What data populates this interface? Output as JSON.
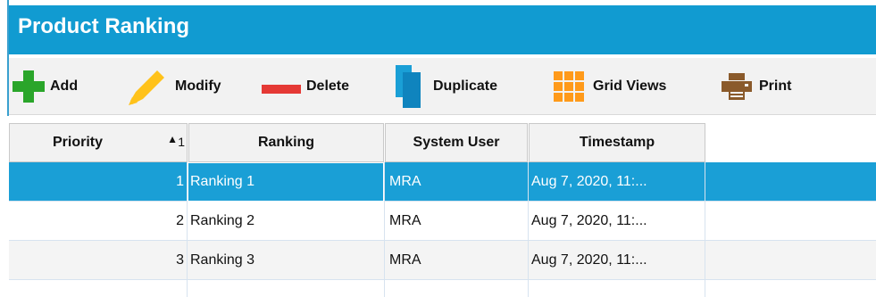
{
  "window": {
    "title": "Product Ranking"
  },
  "toolbar": {
    "add": "Add",
    "modify": "Modify",
    "delete": "Delete",
    "duplicate": "Duplicate",
    "grid_views": "Grid Views",
    "print": "Print"
  },
  "grid": {
    "columns": [
      "Priority",
      "Ranking",
      "System User",
      "Timestamp"
    ],
    "sort_indicator": "1",
    "rows": [
      {
        "priority": "1",
        "ranking": "Ranking 1",
        "user": "MRA",
        "timestamp": "Aug 7, 2020, 11:..."
      },
      {
        "priority": "2",
        "ranking": "Ranking 2",
        "user": "MRA",
        "timestamp": "Aug 7, 2020, 11:..."
      },
      {
        "priority": "3",
        "ranking": "Ranking 3",
        "user": "MRA",
        "timestamp": "Aug 7, 2020, 11:..."
      }
    ]
  },
  "colors": {
    "title_bar": "#119bd1",
    "selection": "#1a9fd6",
    "add": "#2aa52a",
    "delete": "#e53935",
    "grid_icon": "#ff9a1a"
  },
  "icons": [
    "plus-icon",
    "pencil-icon",
    "minus-icon",
    "duplicate-icon",
    "grid-icon",
    "printer-icon",
    "sort-ascending-icon"
  ]
}
